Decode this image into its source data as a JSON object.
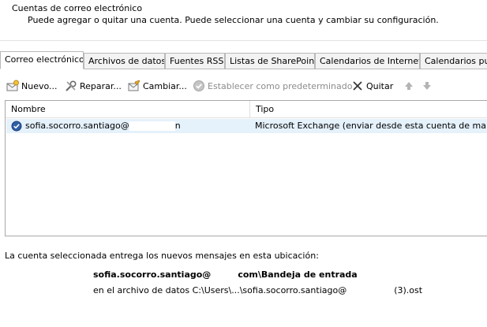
{
  "header": {
    "title": "Cuentas de correo electrónico",
    "description": "Puede agregar o quitar una cuenta. Puede seleccionar una cuenta y cambiar su configuración."
  },
  "tabs": [
    {
      "label": "Correo electrónico",
      "active": true
    },
    {
      "label": "Archivos de datos",
      "active": false
    },
    {
      "label": "Fuentes RSS",
      "active": false
    },
    {
      "label": "Listas de SharePoint",
      "active": false
    },
    {
      "label": "Calendarios de Internet",
      "active": false
    },
    {
      "label": "Calendarios pu",
      "active": false
    }
  ],
  "toolbar": {
    "new_label": "Nuevo...",
    "repair_label": "Reparar...",
    "change_label": "Cambiar...",
    "set_default_label": "Establecer como predeterminado",
    "remove_label": "Quitar",
    "move_up_icon": "arrow-up-icon",
    "move_down_icon": "arrow-down-icon"
  },
  "list": {
    "columns": {
      "name": "Nombre",
      "type": "Tipo"
    },
    "rows": [
      {
        "name": "sofia.socorro.santiago@",
        "name_tail": "n",
        "type": "Microsoft Exchange (enviar desde esta cuenta de maner..."
      }
    ]
  },
  "delivery": {
    "info": "La cuenta seleccionada entrega los nuevos mensajes en esta ubicación:",
    "folder_prefix": "sofia.socorro.santiago@",
    "folder_suffix": "com\\Bandeja de entrada",
    "file_prefix": "en el archivo de datos C:\\Users\\...\\sofia.socorro.santiago@",
    "file_suffix": "(3).ost"
  },
  "colors": {
    "selected_row": "#e5f1fb",
    "tab_border": "#b9b9b9",
    "disabled_text": "#8c8c8c"
  }
}
